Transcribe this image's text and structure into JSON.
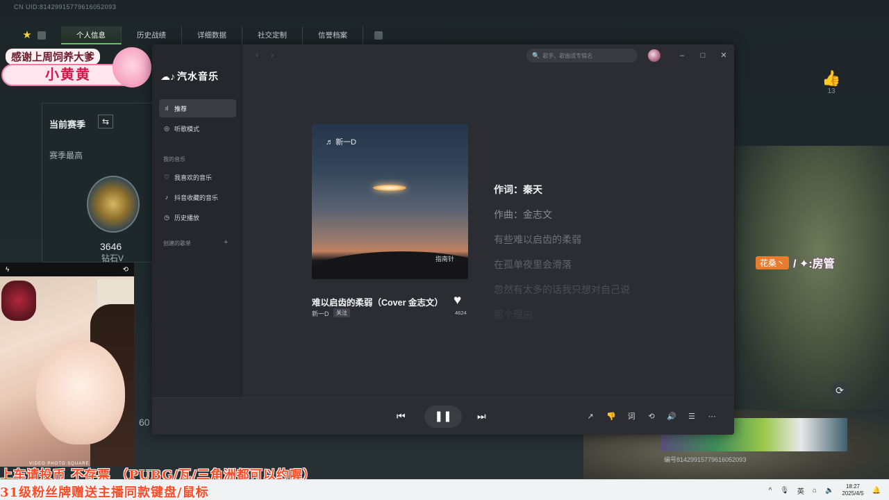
{
  "game": {
    "uid_top": "CN UID:8142991577961605209З",
    "tabs": [
      "个人信息",
      "历史战绩",
      "详细数据",
      "社交定制",
      "信誉档案"
    ],
    "season_title": "当前赛季",
    "season_best": "赛季最高",
    "rank_score": "3646",
    "rank_name": "钻石V",
    "left_number": "60",
    "like_count": "13",
    "uid_bottom": "编号8142991577961605209З"
  },
  "gift": {
    "thanks": "感谢上周饲养大爹",
    "name": "小黄黄"
  },
  "mod_overlay": {
    "tag": "花桑丶",
    "role": "房管"
  },
  "music": {
    "app_name": "汽水音乐",
    "search_placeholder": "歌手、歌曲或专辑名",
    "nav": [
      {
        "label": "推荐",
        "icon": "equalizer-icon"
      },
      {
        "label": "听歌模式",
        "icon": "compass-icon"
      }
    ],
    "my_music_header": "我的音乐",
    "my_music": [
      {
        "label": "我喜欢的音乐",
        "icon": "heart-outline-icon"
      },
      {
        "label": "抖音收藏的音乐",
        "icon": "tiktok-icon"
      },
      {
        "label": "历史播放",
        "icon": "history-icon"
      }
    ],
    "created_header": "创建的歌单",
    "album_artist": "新一D",
    "album_signature": "指南针",
    "song_title": "难以启齿的柔弱（Cover 金志文）",
    "artist": "新一D",
    "follow_label": "关注",
    "like_count": "4624",
    "lyrics": [
      "作词：秦天",
      "作曲：金志文",
      "有些难以启齿的柔弱",
      "在孤单夜里会滑落",
      "忽然有太多的话我只想对自己说",
      "那个理由"
    ],
    "window_controls": {
      "minimize": "–",
      "maximize": "□",
      "close": "✕"
    }
  },
  "overlays": {
    "banner_line1": "上车请投币 不存票 （PUBG/瓦/三角洲都可以约喔）",
    "banner_line2": "31级粉丝牌赠送主播同款键盘/鼠标",
    "cam_modes": "VIDEO  PHOTO  SQUARE"
  },
  "taskbar": {
    "time": "18:27",
    "date": "2025/4/5"
  },
  "colors": {
    "music_bg": "#2b2d33",
    "sidebar_bg": "#25272c",
    "accent_green": "#6bbf6a",
    "banner_red": "#ff4a26",
    "mod_orange": "#e97b2c"
  }
}
